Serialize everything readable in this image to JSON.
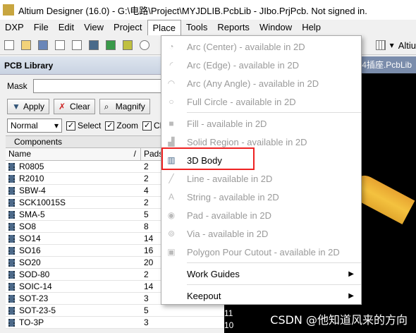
{
  "window": {
    "title": "Altium Designer (16.0) - G:\\电路\\Project\\MYJDLIB.PcbLib - JIbo.PrjPcb. Not signed in."
  },
  "menubar": {
    "items": [
      {
        "label": "DXP"
      },
      {
        "label": "File"
      },
      {
        "label": "Edit"
      },
      {
        "label": "View"
      },
      {
        "label": "Project"
      },
      {
        "label": "Place"
      },
      {
        "label": "Tools"
      },
      {
        "label": "Reports"
      },
      {
        "label": "Window"
      },
      {
        "label": "Help"
      }
    ]
  },
  "toolbar": {
    "right_label": "Altiu"
  },
  "panel": {
    "title": "PCB Library",
    "mask_label": "Mask",
    "mask_value": "",
    "apply_label": "Apply",
    "clear_label": "Clear",
    "magnify_label": "Magnify",
    "mode_value": "Normal",
    "select_label": "Select",
    "zoom_label": "Zoom",
    "cl_label": "Cl",
    "grid_title": "Components",
    "col_name": "Name",
    "col_pads": "Pads",
    "sort_indicator": "/",
    "rows": [
      {
        "name": "R0805",
        "pads": "2"
      },
      {
        "name": "R2010",
        "pads": "2"
      },
      {
        "name": "SBW-4",
        "pads": "4"
      },
      {
        "name": "SCK10015S",
        "pads": "2"
      },
      {
        "name": "SMA-5",
        "pads": "5"
      },
      {
        "name": "SO8",
        "pads": "8"
      },
      {
        "name": "SO14",
        "pads": "14"
      },
      {
        "name": "SO16",
        "pads": "16"
      },
      {
        "name": "SO20",
        "pads": "20"
      },
      {
        "name": "SOD-80",
        "pads": "2"
      },
      {
        "name": "SOIC-14",
        "pads": "14"
      },
      {
        "name": "SOT-23",
        "pads": "3"
      },
      {
        "name": "SOT-23-5",
        "pads": "5"
      },
      {
        "name": "TO-3P",
        "pads": "3"
      }
    ]
  },
  "canvas": {
    "tab_label": ".54插座.PcbLib",
    "extra_col": [
      "11",
      "10"
    ],
    "watermark": "CSDN @他知道风来的方向"
  },
  "place_menu": {
    "items": [
      {
        "label": "Arc (Center) - available in 2D",
        "icon": "arc-center-icon",
        "enabled": false
      },
      {
        "label": "Arc (Edge) - available in 2D",
        "icon": "arc-edge-icon",
        "enabled": false
      },
      {
        "label": "Arc (Any Angle) - available in 2D",
        "icon": "arc-any-icon",
        "enabled": false
      },
      {
        "label": "Full Circle - available in 2D",
        "icon": "circle-icon",
        "enabled": false
      },
      {
        "label": "Fill - available in 2D",
        "icon": "fill-icon",
        "enabled": false
      },
      {
        "label": "Solid Region - available in 2D",
        "icon": "solid-region-icon",
        "enabled": false
      },
      {
        "label": "3D Body",
        "icon": "3d-body-icon",
        "enabled": true
      },
      {
        "label": "Line - available in 2D",
        "icon": "line-icon",
        "enabled": false
      },
      {
        "label": "String - available in 2D",
        "icon": "string-icon",
        "enabled": false
      },
      {
        "label": "Pad - available in 2D",
        "icon": "pad-icon",
        "enabled": false
      },
      {
        "label": "Via - available in 2D",
        "icon": "via-icon",
        "enabled": false
      },
      {
        "label": "Polygon Pour Cutout - available in 2D",
        "icon": "polygon-cutout-icon",
        "enabled": false
      },
      {
        "label": "Work Guides",
        "icon": "",
        "enabled": true,
        "submenu": true
      },
      {
        "label": "Keepout",
        "icon": "",
        "enabled": true,
        "submenu": true
      }
    ]
  },
  "colors": {
    "highlight": "#e22222",
    "panel_header": "#c9d3e2",
    "canvas_bg": "#000000",
    "rod": "#f4c23f"
  }
}
